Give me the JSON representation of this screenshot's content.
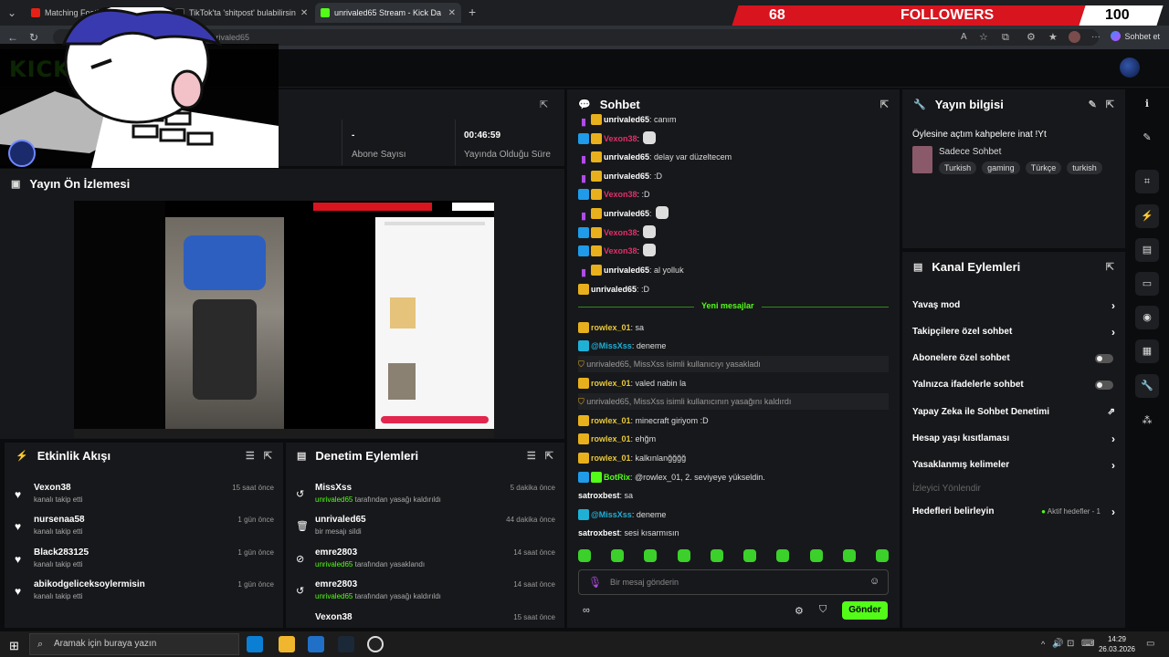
{
  "tabs": [
    {
      "label": "Matching Football Kits for ...",
      "active": false
    },
    {
      "label": "TikTok'ta 'shitpost' bulabilirsin",
      "active": false
    },
    {
      "label": "unrivaled65 Stream - Kick Da",
      "active": true
    }
  ],
  "browser": {
    "url": "https://kick.com/.../unrivaled65",
    "url_suffix": "/unrivaled65",
    "sohbet_et": "Sohbet et"
  },
  "overlay": {
    "followers_current": "68",
    "followers_label": "FOLLOWERS",
    "followers_goal": "100"
  },
  "stats": {
    "subscribers_value": "-",
    "subscribers_label": "Abone Sayısı",
    "live_time_value": "00:46:59",
    "live_time_label": "Yayında Olduğu Süre"
  },
  "preview": {
    "title": "Yayın Ön İzlemesi"
  },
  "activity": {
    "title": "Etkinlik Akışı",
    "items": [
      {
        "name": "Vexon38",
        "action": "kanalı takip etti",
        "time": "15 saat önce"
      },
      {
        "name": "nursenaa58",
        "action": "kanalı takip etti",
        "time": "1 gün önce"
      },
      {
        "name": "Black283125",
        "action": "kanalı takip etti",
        "time": "1 gün önce"
      },
      {
        "name": "abikodgeliceksoylermisin",
        "action": "kanalı takip etti",
        "time": "1 gün önce"
      }
    ]
  },
  "moderation": {
    "title": "Denetim Eylemleri",
    "items": [
      {
        "name": "MissXss",
        "actor": "unrivaled65",
        "action": " tarafından yasağı kaldırıldı",
        "time": "5 dakika önce"
      },
      {
        "name": "unrivaled65",
        "actor": "",
        "action": "bir mesajı sildi",
        "time": "44 dakika önce"
      },
      {
        "name": "emre2803",
        "actor": "unrivaled65",
        "action": " tarafından yasaklandı",
        "time": "14 saat önce"
      },
      {
        "name": "emre2803",
        "actor": "unrivaled65",
        "action": " tarafından yasağı kaldırıldı",
        "time": "14 saat önce"
      },
      {
        "name": "Vexon38",
        "actor": "",
        "action": "",
        "time": "15 saat önce"
      }
    ]
  },
  "chat": {
    "title": "Sohbet",
    "new_messages": "Yeni mesajlar",
    "input_placeholder": "Bir mesaj gönderin",
    "send": "Gönder",
    "messages": [
      {
        "user": "unrivaled65",
        "text": " canım",
        "color": "#ffffff",
        "badges": [
          "mic",
          "crown"
        ]
      },
      {
        "user": "Vexon38",
        "text": "",
        "color": "#e0306a",
        "badges": [
          "mod",
          "crown"
        ],
        "emote": true
      },
      {
        "user": "unrivaled65",
        "text": " delay var düzeltecem",
        "color": "#ffffff",
        "badges": [
          "mic",
          "crown"
        ]
      },
      {
        "user": "unrivaled65",
        "text": " :D",
        "color": "#ffffff",
        "badges": [
          "mic",
          "crown"
        ]
      },
      {
        "user": "Vexon38",
        "text": " :D",
        "color": "#e0306a",
        "badges": [
          "mod",
          "crown"
        ]
      },
      {
        "user": "unrivaled65",
        "text": "",
        "color": "#ffffff",
        "badges": [
          "mic",
          "crown"
        ],
        "emote": true
      },
      {
        "user": "Vexon38",
        "text": "",
        "color": "#e0306a",
        "badges": [
          "mod",
          "crown"
        ],
        "emote": true
      },
      {
        "user": "Vexon38",
        "text": "",
        "color": "#e0306a",
        "badges": [
          "mod",
          "crown"
        ],
        "emote": true
      },
      {
        "user": "unrivaled65",
        "text": " al yolluk",
        "color": "#ffffff",
        "badges": [
          "mic",
          "crown"
        ]
      },
      {
        "user": "unrivaled65",
        "text": " :D",
        "color": "#ffffff",
        "badges": [
          "crown"
        ]
      },
      {
        "user": "rowlex_01",
        "text": " sa",
        "color": "#e8c93a",
        "badges": [
          "crown"
        ]
      },
      {
        "user": "@MissXss",
        "text": " deneme",
        "color": "#1fb0d6",
        "badges": [
          "bot"
        ]
      },
      {
        "system": true,
        "text": "unrivaled65, MissXss isimli kullanıcıyı yasakladı"
      },
      {
        "user": "rowlex_01",
        "text": " valed nabin la",
        "color": "#e8c93a",
        "badges": [
          "crown"
        ]
      },
      {
        "system": true,
        "text": "unrivaled65, MissXss isimli kullanıcının yasağını kaldırdı"
      },
      {
        "user": "rowlex_01",
        "text": " minecraft giriyom :D",
        "color": "#e8c93a",
        "badges": [
          "crown"
        ]
      },
      {
        "user": "rowlex_01",
        "text": " ehğm",
        "color": "#e8c93a",
        "badges": [
          "crown"
        ]
      },
      {
        "user": "rowlex_01",
        "text": " kalkınlanğğğğ",
        "color": "#e8c93a",
        "badges": [
          "crown"
        ]
      },
      {
        "user": "BotRix",
        "text": " @rowlex_01, 2. seviyeye yükseldin.",
        "color": "#53fc18",
        "badges": [
          "mod",
          "ver"
        ]
      },
      {
        "user": "satroxbest",
        "text": " sa",
        "color": "#ffffff",
        "badges": []
      },
      {
        "user": "@MissXss",
        "text": " deneme",
        "color": "#1fb0d6",
        "badges": [
          "bot"
        ]
      },
      {
        "user": "satroxbest",
        "text": " sesi kısarmısın",
        "color": "#ffffff",
        "badges": []
      }
    ]
  },
  "stream_info": {
    "title": "Yayın bilgisi",
    "stream_title": "Öylesine açtım kahpelere inat !Yt",
    "category": "Sadece Sohbet",
    "tags": [
      "Turkish",
      "gaming",
      "Türkçe",
      "turkish"
    ]
  },
  "channel_actions": {
    "title": "Kanal Eylemleri",
    "items": [
      {
        "label": "Yavaş mod",
        "control": "chevron"
      },
      {
        "label": "Takipçilere özel sohbet",
        "control": "chevron"
      },
      {
        "label": "Abonelere özel sohbet",
        "control": "toggle"
      },
      {
        "label": "Yalnızca ifadelerle sohbet",
        "control": "toggle"
      },
      {
        "label": "Yapay Zeka ile Sohbet Denetimi",
        "control": "external"
      },
      {
        "label": "Hesap yaşı kısıtlaması",
        "control": "chevron"
      },
      {
        "label": "Yasaklanmış kelimeler",
        "control": "chevron"
      },
      {
        "label": "İzleyici Yönlendir",
        "control": "none",
        "disabled": true
      },
      {
        "label": "Hedefleri belirleyin",
        "control": "chevron",
        "extra": "Aktif hedefler - 1"
      }
    ]
  },
  "taskbar": {
    "search_placeholder": "Aramak için buraya yazın",
    "time": "14:29",
    "date": "26.03.2026"
  },
  "colors": {
    "accent": "#53fc18",
    "overlay_red": "#d8141f"
  }
}
